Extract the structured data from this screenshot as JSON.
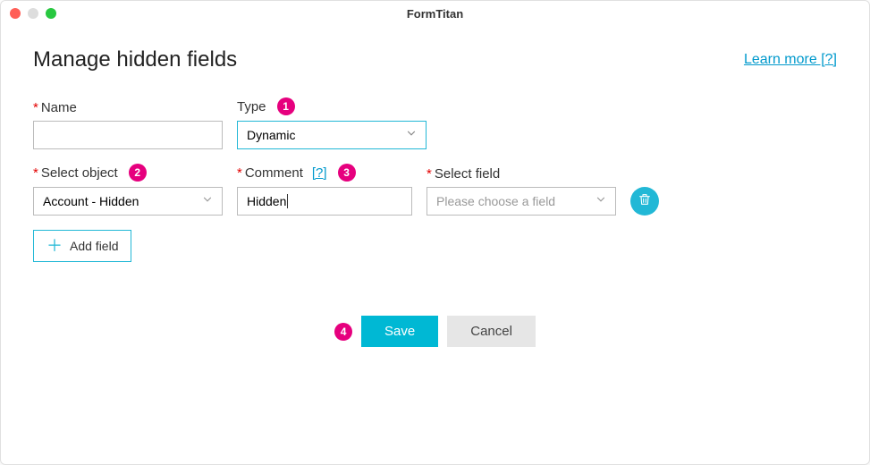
{
  "window": {
    "title": "FormTitan"
  },
  "header": {
    "title": "Manage hidden fields",
    "learn_more": "Learn more  [?]"
  },
  "annotations": {
    "b1": "1",
    "b2": "2",
    "b3": "3",
    "b4": "4"
  },
  "fields": {
    "name": {
      "label": "Name",
      "required": "*",
      "value": ""
    },
    "type": {
      "label": "Type",
      "value": "Dynamic"
    },
    "select_object": {
      "label": "Select object",
      "required": "*",
      "value": "Account - Hidden"
    },
    "comment": {
      "label": "Comment",
      "required": "*",
      "help": "[?]",
      "value": "Hidden"
    },
    "select_field": {
      "label": "Select field",
      "required": "*",
      "placeholder": "Please choose a field"
    }
  },
  "buttons": {
    "add_field": "Add field",
    "save": "Save",
    "cancel": "Cancel"
  }
}
